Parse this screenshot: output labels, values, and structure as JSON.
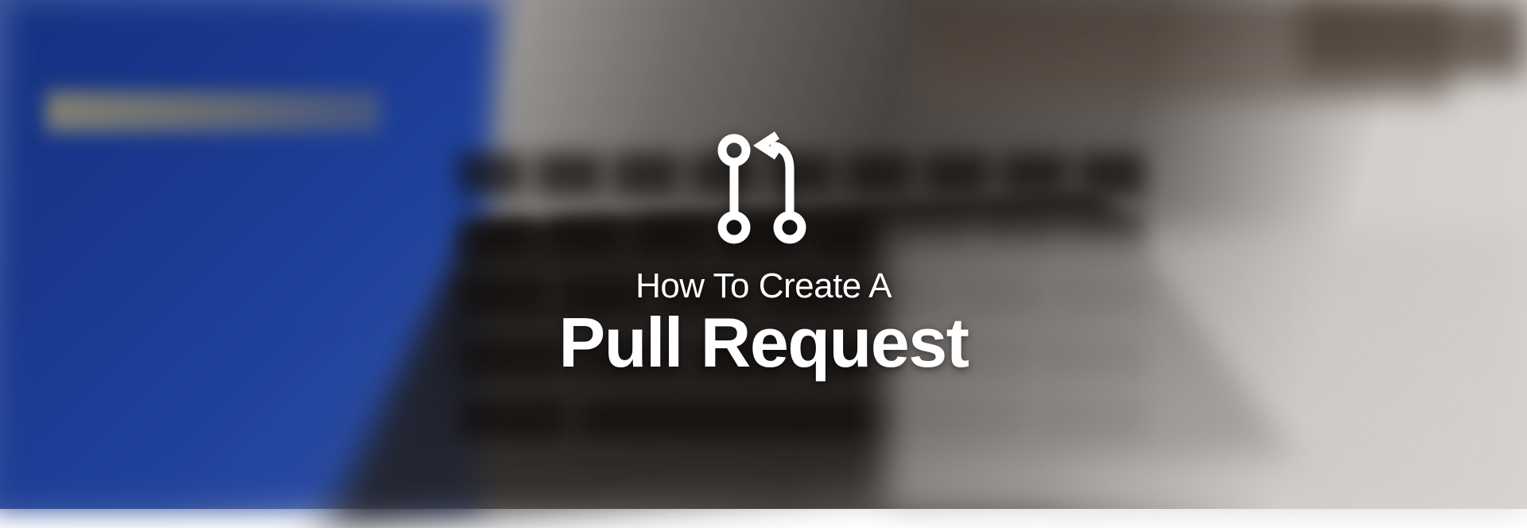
{
  "hero": {
    "subtitle": "How To Create A",
    "title": "Pull Request",
    "icon_name": "git-pull-request-icon"
  }
}
